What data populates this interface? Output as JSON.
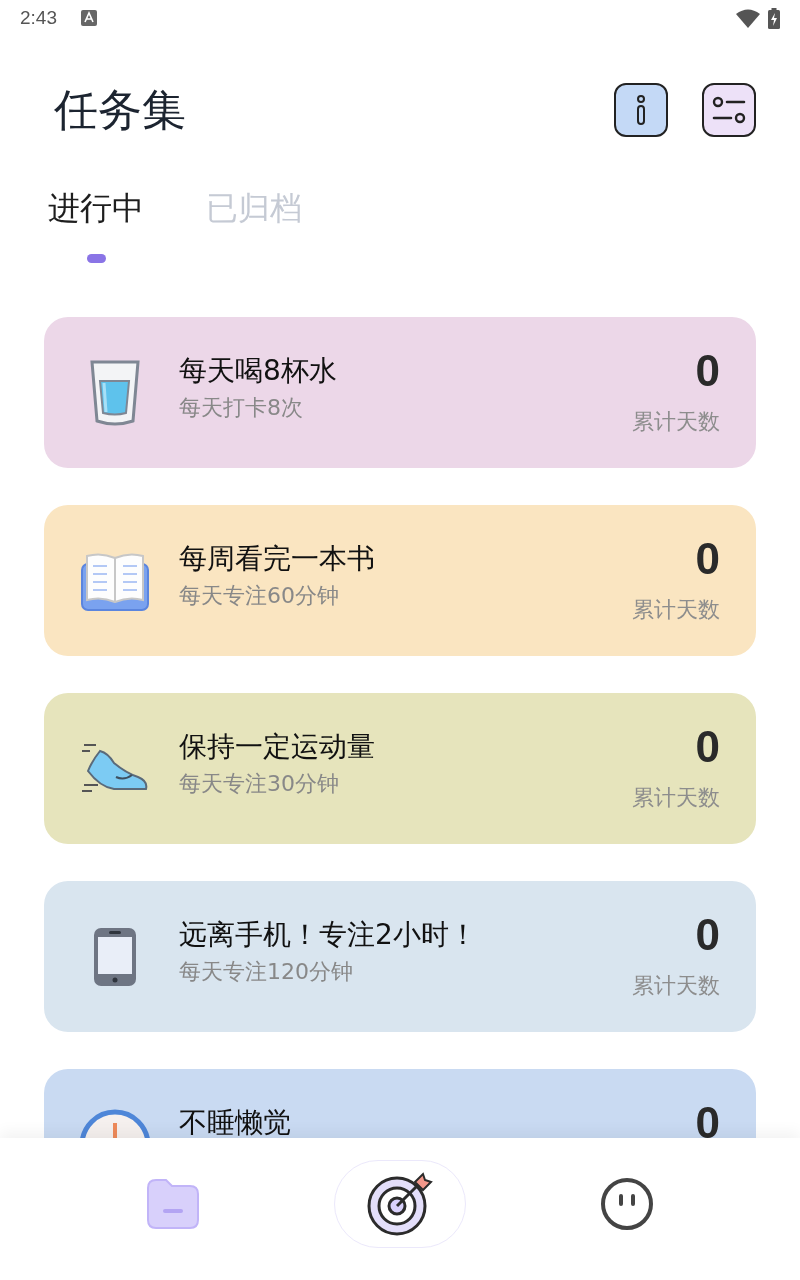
{
  "status_bar": {
    "time": "2:43"
  },
  "header": {
    "title": "任务集"
  },
  "tabs": [
    {
      "label": "进行中",
      "selected": true
    },
    {
      "label": "已归档",
      "selected": false
    }
  ],
  "tasks": [
    {
      "title": "每天喝8杯水",
      "subtitle": "每天打卡8次",
      "count": "0",
      "count_label": "累计天数",
      "color": "#ecd7e8"
    },
    {
      "title": "每周看完一本书",
      "subtitle": "每天专注60分钟",
      "count": "0",
      "count_label": "累计天数",
      "color": "#fae5c1"
    },
    {
      "title": "保持一定运动量",
      "subtitle": "每天专注30分钟",
      "count": "0",
      "count_label": "累计天数",
      "color": "#e6e4bc"
    },
    {
      "title": "远离手机！专注2小时！",
      "subtitle": "每天专注120分钟",
      "count": "0",
      "count_label": "累计天数",
      "color": "#d9e5ef"
    },
    {
      "title": "不睡懒觉",
      "count": "0",
      "color": "#c9daf2"
    }
  ],
  "bottom_nav": [
    {
      "selected": false
    },
    {
      "selected": true
    },
    {
      "selected": false
    }
  ]
}
